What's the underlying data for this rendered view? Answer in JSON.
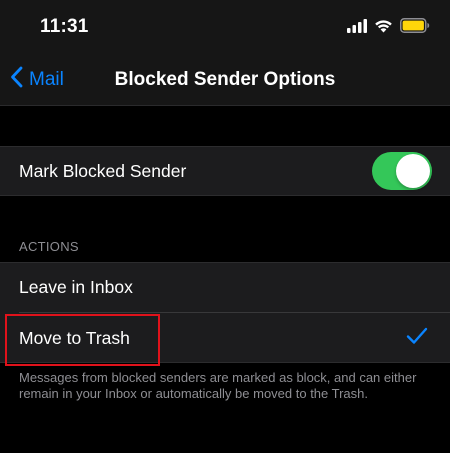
{
  "status_bar": {
    "time": "11:31",
    "icons": [
      "signal-icon",
      "wifi-icon",
      "battery-icon"
    ],
    "battery_color": "#ffd60a"
  },
  "nav": {
    "back_label": "Mail",
    "title": "Blocked Sender Options"
  },
  "mark_group": {
    "label": "Mark Blocked Sender",
    "toggle_on": true,
    "toggle_color": "#34c759"
  },
  "actions": {
    "header": "ACTIONS",
    "options": [
      {
        "label": "Leave in Inbox",
        "selected": false
      },
      {
        "label": "Move to Trash",
        "selected": true
      }
    ]
  },
  "footer": {
    "text": "Messages from blocked senders are marked as block, and can either remain in your Inbox or automatically be moved to the Trash."
  },
  "colors": {
    "accent": "#0a84ff",
    "highlight": "#e0121b"
  }
}
